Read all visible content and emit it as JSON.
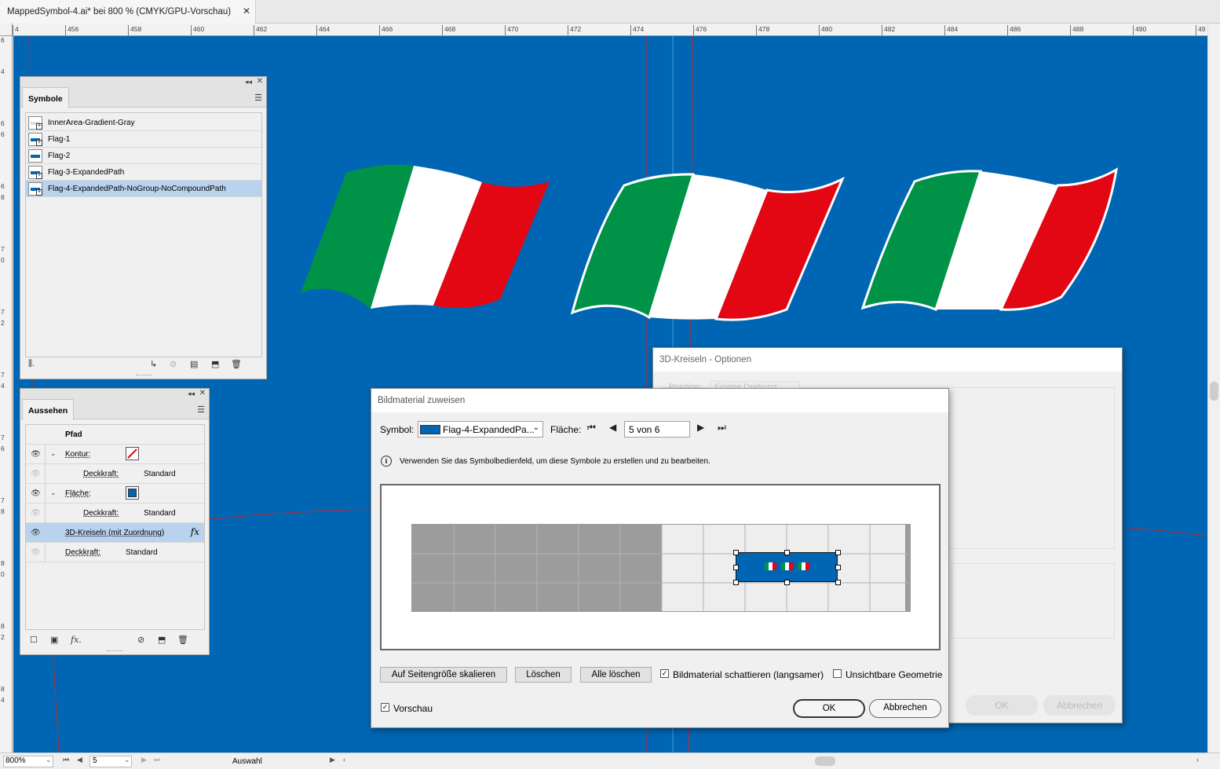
{
  "document_tab": {
    "title": "MappedSymbol-4.ai* bei 800 % (CMYK/GPU-Vorschau)",
    "close": "✕"
  },
  "rulers": {
    "horizontal": [
      "4",
      "456",
      "458",
      "460",
      "462",
      "464",
      "466",
      "468",
      "470",
      "472",
      "474",
      "476",
      "478",
      "480",
      "482",
      "484",
      "486",
      "488",
      "490",
      "49"
    ],
    "vertical": [
      "6",
      "4",
      "6",
      "6",
      "6",
      "8",
      "7",
      "0",
      "7",
      "2",
      "7",
      "4",
      "7",
      "6",
      "7",
      "8",
      "8",
      "0",
      "8",
      "2",
      "8",
      "4"
    ]
  },
  "symbols_panel": {
    "tab": "Symbole",
    "menu_icon": "menu-icon",
    "items": [
      {
        "label": "InnerArea-Gradient-Gray",
        "selected": false
      },
      {
        "label": "Flag-1",
        "selected": false
      },
      {
        "label": "Flag-2",
        "selected": false
      },
      {
        "label": "Flag-3-ExpandedPath",
        "selected": false
      },
      {
        "label": "Flag-4-ExpandedPath-NoGroup-NoCompoundPath",
        "selected": true
      }
    ],
    "footer_icons": [
      "library-icon",
      "place-instance-icon",
      "break-link-icon",
      "options-icon",
      "new-symbol-icon",
      "delete-icon"
    ]
  },
  "appearance_panel": {
    "tab": "Aussehen",
    "header": "Pfad",
    "rows": [
      {
        "label": "Kontur:",
        "type": "stroke"
      },
      {
        "label": "Deckkraft:",
        "value": "Standard"
      },
      {
        "label": "Fläche:",
        "type": "fill"
      },
      {
        "label": "Deckkraft:",
        "value": "Standard"
      },
      {
        "label": "3D-Kreiseln (mit Zuordnung)",
        "fx": "fx"
      },
      {
        "label": "Deckkraft:",
        "value": "Standard"
      }
    ],
    "fill_color": "#0066b3",
    "footer_icons": [
      "add-stroke-icon",
      "add-fill-icon",
      "fx-icon",
      "clear-icon",
      "duplicate-icon",
      "delete-icon"
    ]
  },
  "dialog_3d": {
    "title": "3D-Kreiseln - Optionen",
    "position_label": "Position:",
    "position_value": "Eigene Drehung",
    "ok": "OK",
    "cancel": "Abbrechen"
  },
  "dialog_main": {
    "title": "Bildmaterial zuweisen",
    "symbol_label": "Symbol:",
    "symbol_value": "Flag-4-ExpandedPa...",
    "face_label": "Fläche:",
    "face_value": "5 von 6",
    "info_text": "Verwenden Sie das Symbolbedienfeld, um diese Symbole zu erstellen und zu bearbeiten.",
    "buttons": {
      "scale": "Auf Seitengröße skalieren",
      "delete": "Löschen",
      "delete_all": "Alle löschen",
      "ok": "OK",
      "cancel": "Abbrechen"
    },
    "checkboxes": {
      "shade": {
        "label": "Bildmaterial schattieren (langsamer)",
        "checked": true
      },
      "invisible": {
        "label": "Unsichtbare Geometrie",
        "checked": false
      },
      "preview": {
        "label": "Vorschau",
        "checked": true
      }
    }
  },
  "status_bar": {
    "zoom": "800%",
    "page": "5",
    "selection_tool": "Auswahl"
  },
  "colors": {
    "canvas": "#0066b3",
    "flag_green": "#009246",
    "flag_white": "#ffffff",
    "flag_red": "#e30613",
    "selection_highlight": "#b9d2ee"
  }
}
